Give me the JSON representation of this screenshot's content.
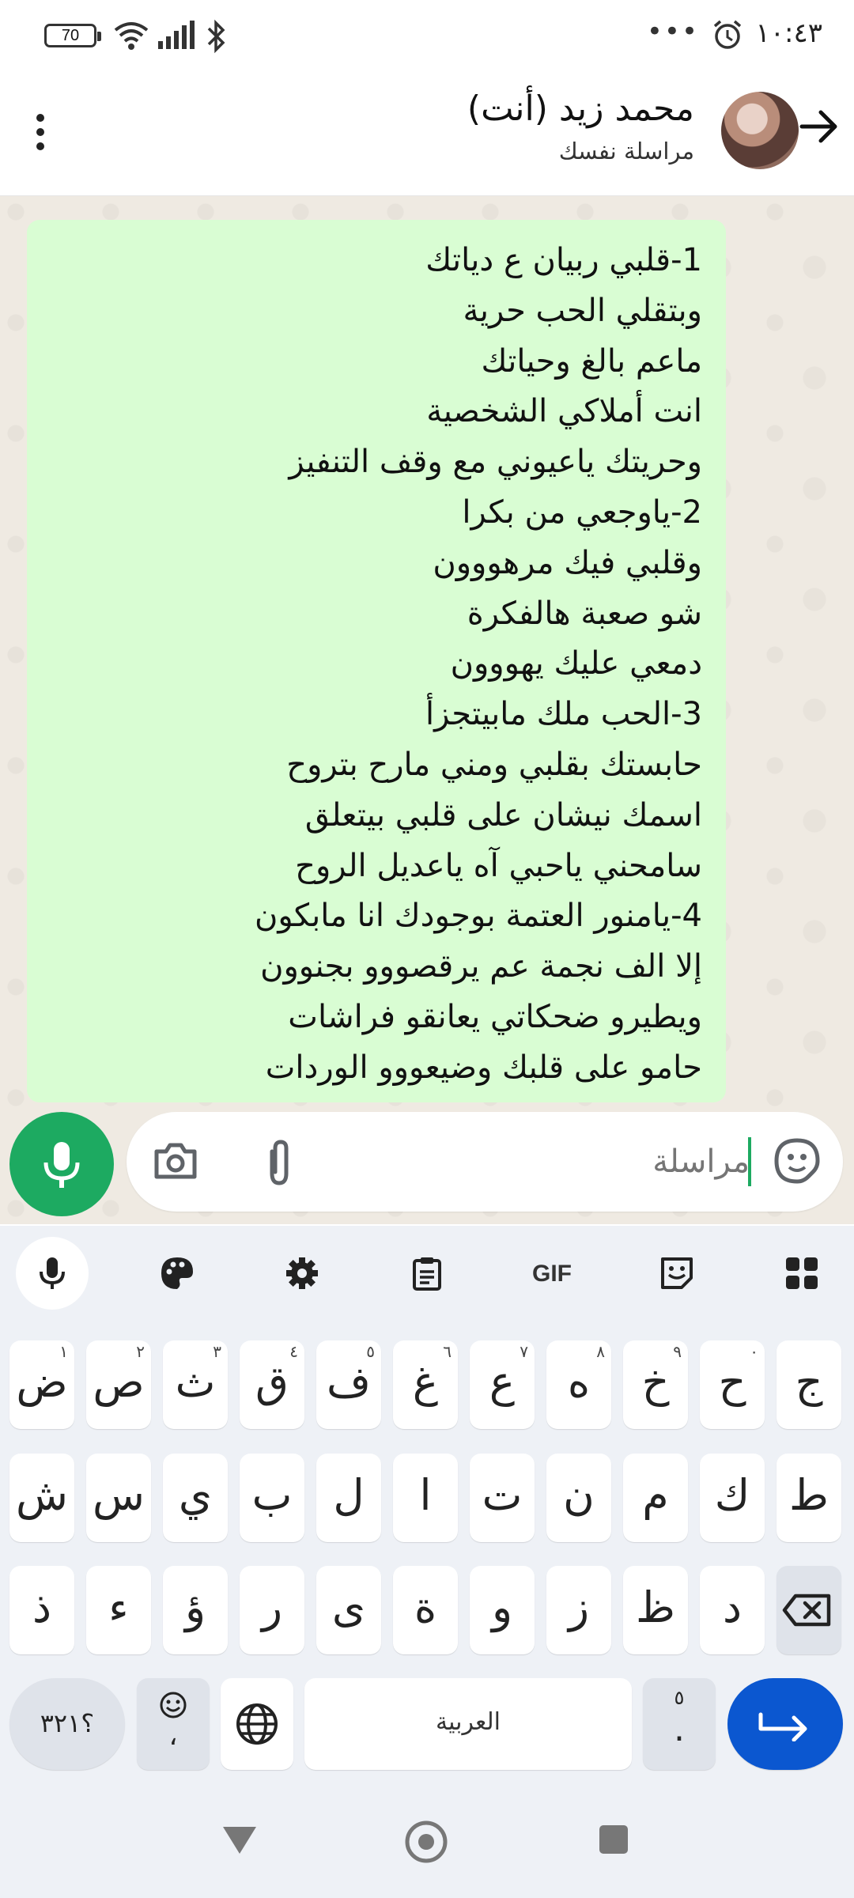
{
  "status_bar": {
    "battery": "70",
    "time": "١٠:٤٣",
    "more": "•••"
  },
  "header": {
    "name": "محمد زيد (أنت)",
    "subtitle": "مراسلة نفسك"
  },
  "message": {
    "lines": [
      "1-قلبي ربيان ع دياتك",
      "وبتقلي الحب حرية",
      "ماعم بالغ وحياتك",
      "انت أملاكي الشخصية",
      "وحريتك ياعيوني مع وقف التنفيز",
      "2-ياوجعي من بكرا",
      "وقلبي فيك مرهووون",
      "شو صعبة هالفكرة",
      "دمعي عليك يهووون",
      "3-الحب ملك مابيتجزأ",
      "حابستك بقلبي ومني مارح بتروح",
      "اسمك نيشان على قلبي بيتعلق",
      "سامحني ياحبي آه ياعديل الروح",
      "4-يامنور العتمة بوجودك انا مابكون",
      "إلا الف نجمة عم يرقصووو بجنوون",
      "ويطيرو ضحكاتي يعانقو فراشات",
      "حامو على قلبك وضيعووو الوردات"
    ]
  },
  "composer": {
    "placeholder": "مراسلة"
  },
  "keyboard": {
    "gif_label": "GIF",
    "row1": [
      {
        "k": "ض",
        "h": "١"
      },
      {
        "k": "ص",
        "h": "٢"
      },
      {
        "k": "ث",
        "h": "٣"
      },
      {
        "k": "ق",
        "h": "٤"
      },
      {
        "k": "ف",
        "h": "٥"
      },
      {
        "k": "غ",
        "h": "٦"
      },
      {
        "k": "ع",
        "h": "٧"
      },
      {
        "k": "ه",
        "h": "٨"
      },
      {
        "k": "خ",
        "h": "٩"
      },
      {
        "k": "ح",
        "h": "٠"
      },
      {
        "k": "ج",
        "h": ""
      }
    ],
    "row2": [
      "ش",
      "س",
      "ي",
      "ب",
      "ل",
      "ا",
      "ت",
      "ن",
      "م",
      "ك",
      "ط"
    ],
    "row3": [
      "ذ",
      "ء",
      "ؤ",
      "ر",
      "ى",
      "ة",
      "و",
      "ز",
      "ظ",
      "د"
    ],
    "symbols_key": "؟٣٢١",
    "emoji_key_sub": "،",
    "space_label": "العربية",
    "period_key": ".",
    "period_hint": "٥"
  }
}
